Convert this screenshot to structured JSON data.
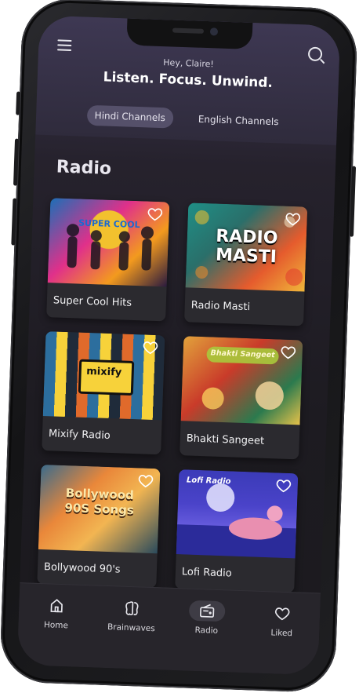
{
  "header": {
    "greeting": "Hey, Claire!",
    "headline": "Listen. Focus. Unwind.",
    "tabs": [
      {
        "label": "Hindi Channels",
        "active": true
      },
      {
        "label": "English Channels",
        "active": false
      }
    ]
  },
  "section": {
    "title": "Radio"
  },
  "stations": [
    {
      "label": "Super Cool Hits",
      "art_text": "SUPER COOL",
      "accent": "#f2c12e"
    },
    {
      "label": "Radio Masti",
      "art_text": "RADIO MASTI",
      "accent": "#e23b2e"
    },
    {
      "label": "Mixify Radio",
      "art_text": "mixify",
      "accent": "#f7d23a"
    },
    {
      "label": "Bhakti Sangeet",
      "art_text": "Bhakti Sangeet",
      "accent": "#d8442c"
    },
    {
      "label": "Bollywood 90's",
      "art_text": "Bollywood 90S Songs",
      "accent": "#e9873a"
    },
    {
      "label": "Lofi Radio",
      "art_text": "Lofi Radio",
      "accent": "#4a43c9"
    }
  ],
  "nav": [
    {
      "label": "Home",
      "icon": "home-icon"
    },
    {
      "label": "Brainwaves",
      "icon": "brain-icon"
    },
    {
      "label": "Radio",
      "icon": "radio-icon",
      "active": true
    },
    {
      "label": "Liked",
      "icon": "heart-icon"
    }
  ],
  "colors": {
    "background": "#1d1b21",
    "header": "#3e3853",
    "tab_active": "#55506a",
    "nav": "#27252b"
  }
}
